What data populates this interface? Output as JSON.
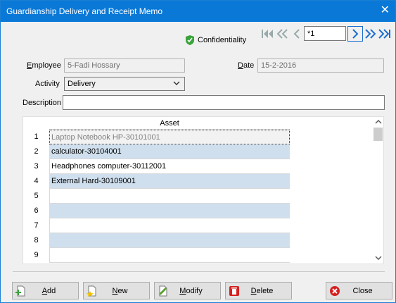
{
  "window": {
    "title": "Guardianship Delivery and Receipt Memo",
    "close_glyph": "✕"
  },
  "nav": {
    "record_value": "*1"
  },
  "confidentiality": {
    "label": "Confidentiality"
  },
  "form": {
    "employee_label_underlined": "E",
    "employee_label_rest": "mployee",
    "employee_value": "5-Fadi Hossary",
    "date_label_underlined": "D",
    "date_label_rest": "ate",
    "date_value": "15-2-2016",
    "activity_label": "Activity",
    "activity_value": "Delivery",
    "description_label": "Description",
    "description_value": ""
  },
  "grid": {
    "column_header": "Asset",
    "rows": [
      {
        "num": "1",
        "asset": "Laptop Notebook HP-30101001"
      },
      {
        "num": "2",
        "asset": "calculator-30104001"
      },
      {
        "num": "3",
        "asset": "Headphones computer-30112001"
      },
      {
        "num": "4",
        "asset": "External Hard-30109001"
      },
      {
        "num": "5",
        "asset": ""
      },
      {
        "num": "6",
        "asset": ""
      },
      {
        "num": "7",
        "asset": ""
      },
      {
        "num": "8",
        "asset": ""
      },
      {
        "num": "9",
        "asset": ""
      }
    ]
  },
  "buttons": {
    "add_u": "A",
    "add_rest": "dd",
    "new_u": "N",
    "new_rest": "ew",
    "modify_u": "M",
    "modify_rest": "odify",
    "delete_u": "D",
    "delete_rest": "elete",
    "close": "Close"
  },
  "colors": {
    "titlebar": "#0a78d7",
    "row_alt": "#cfdfee",
    "accent": "#1a6fd0"
  }
}
